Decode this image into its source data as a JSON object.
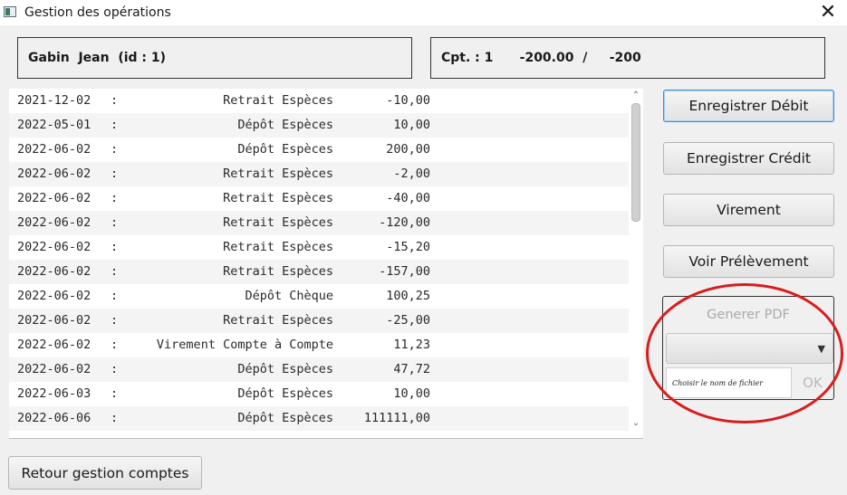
{
  "window": {
    "title": "Gestion des opérations",
    "close_glyph": "✕"
  },
  "client": {
    "label": "Gabin  Jean  (id : 1)"
  },
  "account": {
    "label": "Cpt. : 1      -200.00  /     -200"
  },
  "operations": [
    {
      "date": "2021-12-02",
      "sep": ":",
      "label": "Retrait Espèces",
      "amount": "-10,00"
    },
    {
      "date": "2022-05-01",
      "sep": ":",
      "label": "Dépôt Espèces",
      "amount": "10,00"
    },
    {
      "date": "2022-06-02",
      "sep": ":",
      "label": "Dépôt Espèces",
      "amount": "200,00"
    },
    {
      "date": "2022-06-02",
      "sep": ":",
      "label": "Retrait Espèces",
      "amount": "-2,00"
    },
    {
      "date": "2022-06-02",
      "sep": ":",
      "label": "Retrait Espèces",
      "amount": "-40,00"
    },
    {
      "date": "2022-06-02",
      "sep": ":",
      "label": "Retrait Espèces",
      "amount": "-120,00"
    },
    {
      "date": "2022-06-02",
      "sep": ":",
      "label": "Retrait Espèces",
      "amount": "-15,20"
    },
    {
      "date": "2022-06-02",
      "sep": ":",
      "label": "Retrait Espèces",
      "amount": "-157,00"
    },
    {
      "date": "2022-06-02",
      "sep": ":",
      "label": "Dépôt Chèque",
      "amount": "100,25"
    },
    {
      "date": "2022-06-02",
      "sep": ":",
      "label": "Retrait Espèces",
      "amount": "-25,00"
    },
    {
      "date": "2022-06-02",
      "sep": ":",
      "label": "Virement Compte à Compte",
      "amount": "11,23"
    },
    {
      "date": "2022-06-02",
      "sep": ":",
      "label": "Dépôt Espèces",
      "amount": "47,72"
    },
    {
      "date": "2022-06-03",
      "sep": ":",
      "label": "Dépôt Espèces",
      "amount": "10,00"
    },
    {
      "date": "2022-06-06",
      "sep": ":",
      "label": "Dépôt Espèces",
      "amount": "111111,00"
    },
    {
      "date": "",
      "sep": "",
      "label": "",
      "amount": ""
    }
  ],
  "scrollbar": {
    "up_glyph": "⌃",
    "down_glyph": "⌄"
  },
  "actions": {
    "debit": "Enregistrer Débit",
    "credit": "Enregistrer Crédit",
    "transfer": "Virement",
    "direct_debit": "Voir Prélèvement"
  },
  "pdf": {
    "button": "Generer PDF",
    "select_value": "",
    "select_arrow": "▼",
    "filename_placeholder": "Choisir le nom de fichier",
    "ok": "OK"
  },
  "footer": {
    "back": "Retour gestion comptes"
  },
  "colors": {
    "annotation": "#d91c1c",
    "focus": "#3c8de0"
  }
}
